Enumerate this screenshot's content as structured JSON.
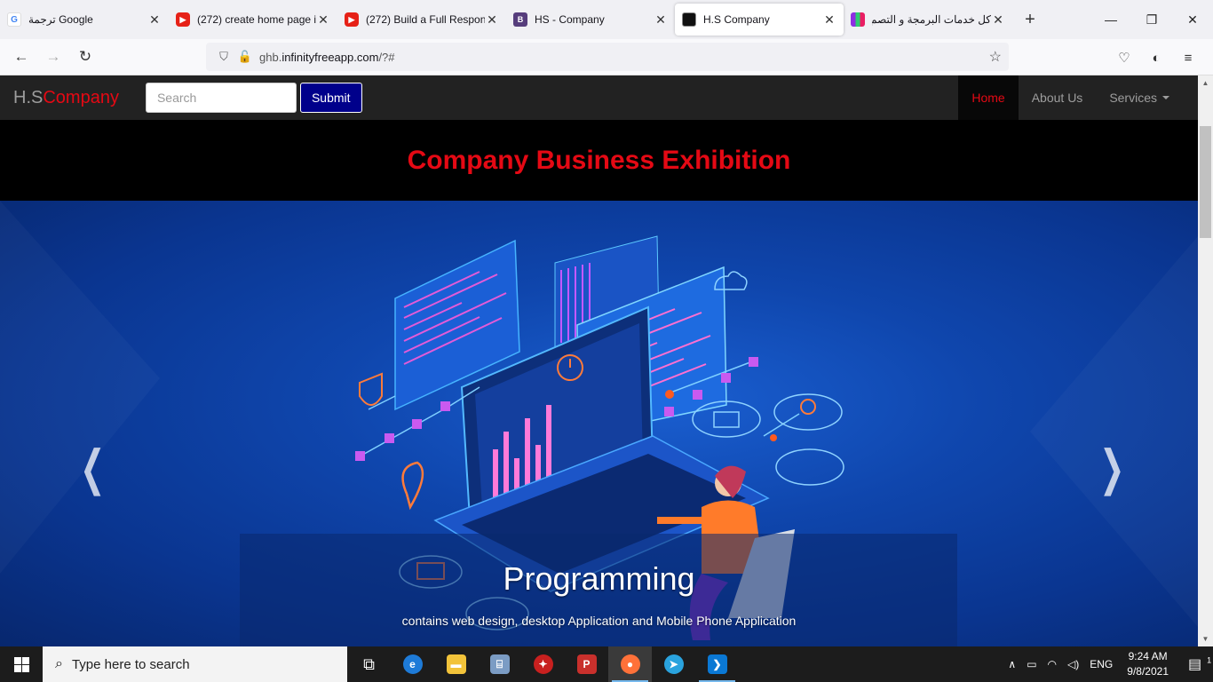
{
  "browser": {
    "tabs": [
      {
        "title": "ترجمة Google",
        "favicon": "google-translate-icon"
      },
      {
        "title": "(272) create home page in",
        "favicon": "youtube-icon"
      },
      {
        "title": "(272) Build a Full Respons",
        "favicon": "youtube-icon"
      },
      {
        "title": "HS - Company",
        "favicon": "bootstrap-icon"
      },
      {
        "title": "H.S Company",
        "favicon": "hs-icon",
        "active": true
      },
      {
        "title": "كل خدمات البرمجة و التصم",
        "favicon": "site-icon"
      }
    ],
    "url_prefix": "ghb.",
    "url_host": "infinityfreeapp.com",
    "url_suffix": "/?#"
  },
  "site": {
    "brand_prefix": "H.S",
    "brand_suffix": "Company",
    "search_placeholder": "Search",
    "submit_label": "Submit",
    "nav": [
      {
        "label": "Home",
        "active": true
      },
      {
        "label": "About Us"
      },
      {
        "label": "Services",
        "dropdown": true
      }
    ],
    "banner_title": "Company Business Exhibition",
    "carousel": {
      "caption_title": "Programming",
      "caption_text": "contains web design, desktop Application and Mobile Phone Application",
      "prev_icon": "chevron-left-icon",
      "next_icon": "chevron-right-icon"
    }
  },
  "taskbar": {
    "search_placeholder": "Type here to search",
    "language": "ENG",
    "time": "9:24 AM",
    "date": "9/8/2021",
    "notifications": "1"
  },
  "colors": {
    "brand_red": "#e50914",
    "submit_blue": "#00008b",
    "hero_blue": "#0f46ad"
  }
}
